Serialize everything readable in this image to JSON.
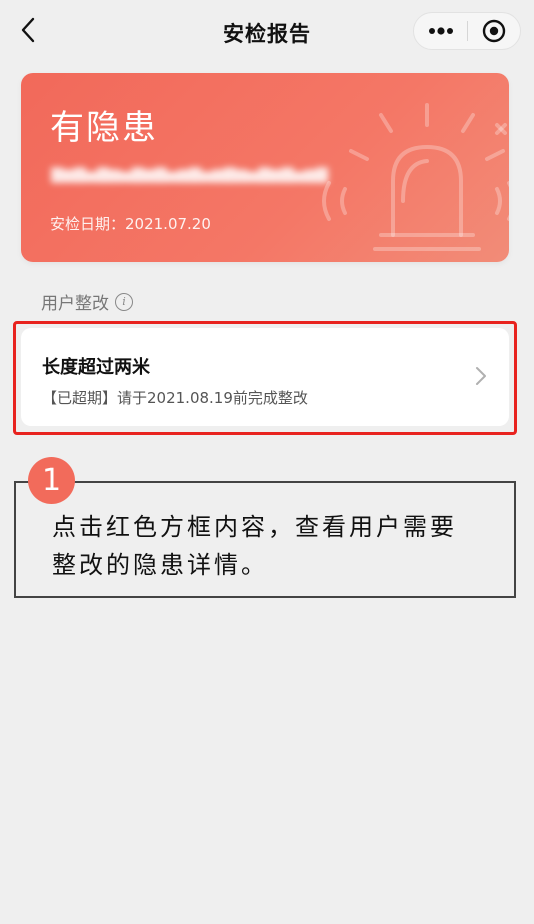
{
  "navbar": {
    "title": "安检报告",
    "back_icon": "chevron-left-icon",
    "more_icon": "more-dots-icon",
    "close_icon": "target-close-icon"
  },
  "hazard_card": {
    "title": "有隐患",
    "date_text": "安检日期：2021.07.20",
    "accent_color": "#f2695a"
  },
  "section": {
    "label": "用户整改",
    "info_icon": "info-icon"
  },
  "rectify_items": [
    {
      "title": "长度超过两米",
      "status": "【已超期】请于2021.08.19前完成整改"
    }
  ],
  "tip": {
    "badge": "1",
    "text": "点击红色方框内容，查看用户需要整改的隐患详情。",
    "badge_color": "#f26b5b",
    "frame_color": "#e8231f"
  }
}
